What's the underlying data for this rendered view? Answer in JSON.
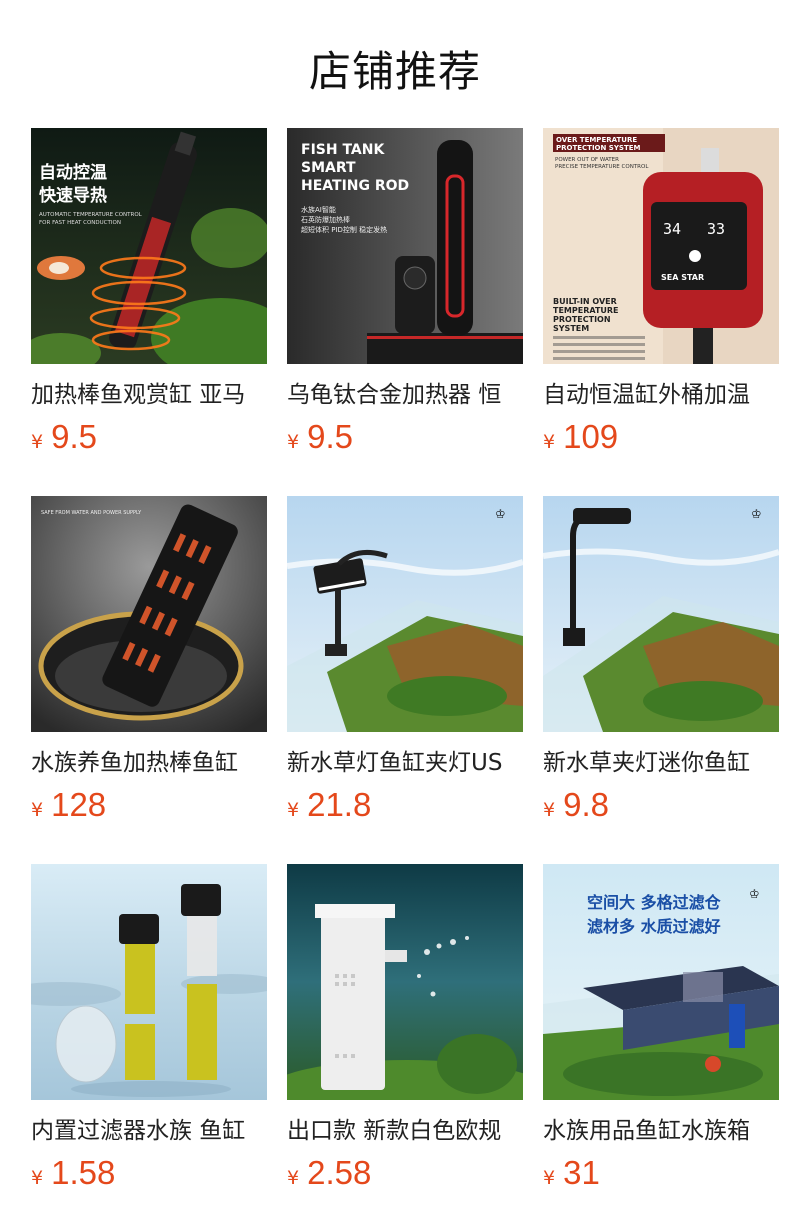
{
  "page_title": "店铺推荐",
  "currency_symbol": "¥",
  "products": [
    {
      "name": "加热棒鱼观赏缸 亚马",
      "price": "9.5",
      "image_text": [
        "自动控温",
        "快速导热",
        "AUTOMATIC TEMPERATURE CONTROL",
        "FOR FAST HEAT CONDUCTION"
      ]
    },
    {
      "name": "乌龟钛合金加热器 恒",
      "price": "9.5",
      "image_text": [
        "FISH TANK",
        "SMART",
        "HEATING ROD",
        "水族AI智能",
        "石英防爆加热棒",
        "超短体积 PID控制 稳定发热"
      ]
    },
    {
      "name": "自动恒温缸外桶加温",
      "price": "109",
      "image_text": [
        "OVER TEMPERATURE",
        "PROTECTION SYSTEM",
        "POWER OUT OF WATER",
        "PRECISE TEMPERATURE CONTROL",
        "BUILT-IN OVER",
        "TEMPERATURE",
        "PROTECTION",
        "SYSTEM",
        "34",
        "33",
        "SEA STAR"
      ]
    },
    {
      "name": "水族养鱼加热棒鱼缸",
      "price": "128",
      "image_text": [
        "SAFE FROM WATER AND POWER SUPPLY"
      ]
    },
    {
      "name": "新水草灯鱼缸夹灯US",
      "price": "21.8",
      "image_text": []
    },
    {
      "name": "新水草夹灯迷你鱼缸",
      "price": "9.8",
      "image_text": []
    },
    {
      "name": "内置过滤器水族 鱼缸",
      "price": "1.58",
      "image_text": []
    },
    {
      "name": "出口款 新款白色欧规",
      "price": "2.58",
      "image_text": []
    },
    {
      "name": "水族用品鱼缸水族箱",
      "price": "31",
      "image_text": [
        "空间大 多格过滤仓",
        "滤材多 水质过滤好"
      ]
    }
  ],
  "colors": {
    "price": "#e4481b",
    "title": "#111111",
    "name": "#222222"
  }
}
